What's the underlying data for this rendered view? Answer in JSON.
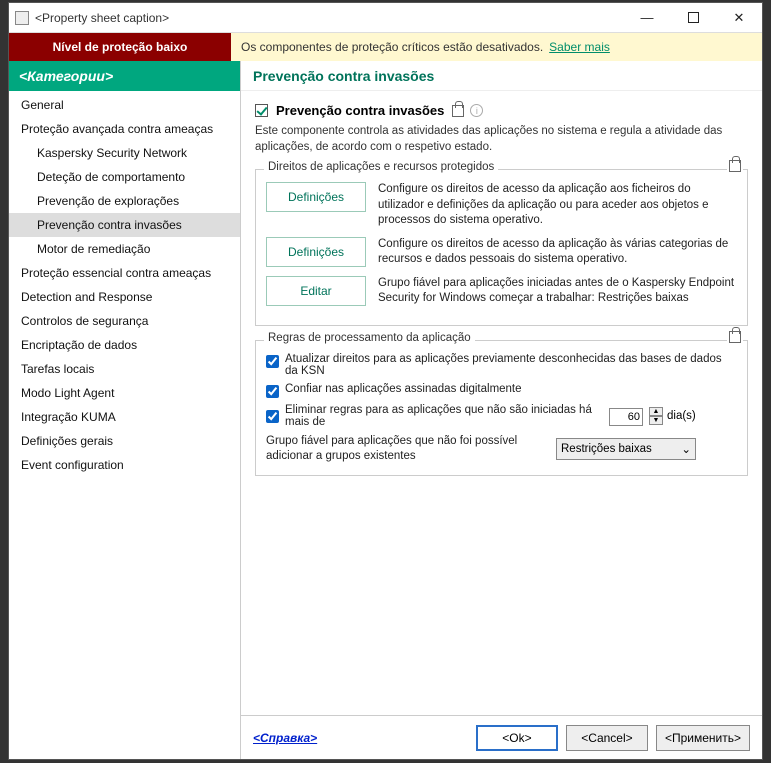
{
  "titlebar": {
    "caption": "<Property sheet caption>"
  },
  "warnbar": {
    "left": "Nível de proteção baixo",
    "right_text": "Os componentes de proteção críticos estão desativados.",
    "link": "Saber mais"
  },
  "sidebar": {
    "header": "<Категории>",
    "items": [
      {
        "label": "General",
        "sub": false
      },
      {
        "label": "Proteção avançada contra ameaças",
        "sub": false
      },
      {
        "label": "Kaspersky Security Network",
        "sub": true
      },
      {
        "label": "Deteção de comportamento",
        "sub": true
      },
      {
        "label": "Prevenção de explorações",
        "sub": true
      },
      {
        "label": "Prevenção contra invasões",
        "sub": true,
        "selected": true
      },
      {
        "label": "Motor de remediação",
        "sub": true
      },
      {
        "label": "Proteção essencial contra ameaças",
        "sub": false
      },
      {
        "label": "Detection and Response",
        "sub": false
      },
      {
        "label": "Controlos de segurança",
        "sub": false
      },
      {
        "label": "Encriptação de dados",
        "sub": false
      },
      {
        "label": "Tarefas locais",
        "sub": false
      },
      {
        "label": "Modo Light Agent",
        "sub": false
      },
      {
        "label": "Integração KUMA",
        "sub": false
      },
      {
        "label": "Definições gerais",
        "sub": false
      },
      {
        "label": "Event configuration",
        "sub": false
      }
    ]
  },
  "main": {
    "header": "Prevenção contra invasões",
    "enable_label": "Prevenção contra invasões",
    "desc": "Este componente controla as atividades das aplicações no sistema e regula a atividade das aplicações, de acordo com o respetivo estado.",
    "group1": {
      "legend": "Direitos de aplicações e recursos protegidos",
      "rows": [
        {
          "btn": "Definições",
          "text": "Configure os direitos de acesso da aplicação aos ficheiros do utilizador e definições da aplicação ou para aceder aos objetos e processos do sistema operativo."
        },
        {
          "btn": "Definições",
          "text": "Configure os direitos de acesso da aplicação às várias categorias de recursos e dados pessoais do sistema operativo."
        },
        {
          "btn": "Editar",
          "text": "Grupo fiável para aplicações iniciadas antes de o Kaspersky Endpoint Security for Windows começar a trabalhar: Restrições baixas"
        }
      ]
    },
    "group2": {
      "legend": "Regras de processamento da aplicação",
      "chk1": "Atualizar direitos para as aplicações previamente desconhecidas das bases de dados da KSN",
      "chk2": "Confiar nas aplicações assinadas digitalmente",
      "chk3": "Eliminar regras para as aplicações que não são iniciadas há mais de",
      "days_value": "60",
      "days_unit": "dia(s)",
      "trust_label": "Grupo fiável para aplicações que não foi possível adicionar a grupos existentes",
      "combo_value": "Restrições baixas"
    }
  },
  "footer": {
    "help": "<Справка>",
    "ok": "<Ok>",
    "cancel": "<Cancel>",
    "apply": "<Применить>"
  }
}
